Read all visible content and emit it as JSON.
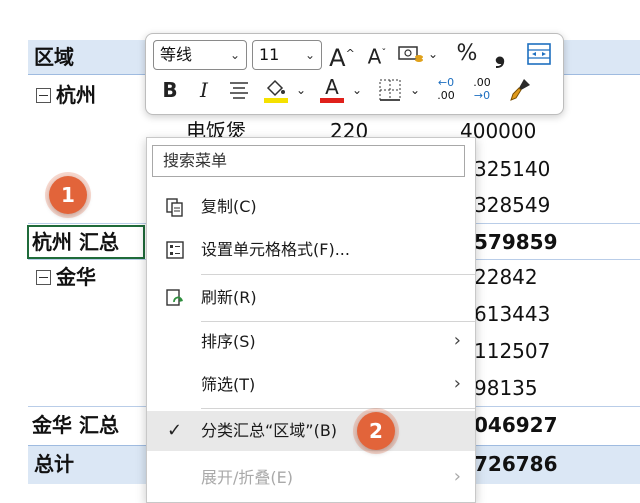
{
  "sheet": {
    "header_label": "区域",
    "group1": {
      "label": "杭州",
      "item": "电饭煲",
      "qty": "220",
      "amount": "400000"
    },
    "partial_values": [
      "325140",
      "328549",
      "579859",
      "22842",
      "613443",
      "112507",
      "98135",
      "046927",
      "726786"
    ],
    "subtotal1": "杭州 汇总",
    "group2": {
      "label": "金华"
    },
    "subtotal2": "金华 汇总",
    "grand_total": "总计"
  },
  "toolbar": {
    "font_name": "等线",
    "font_size": "11",
    "increase_font_glyph": "A",
    "decrease_font_glyph": "A",
    "percent_glyph": "%",
    "comma_glyph": "❟",
    "bold_glyph": "B",
    "italic_glyph": "I",
    "font_color_glyph": "A",
    "decimal_inc_top": "←0",
    "decimal_inc_bottom": ".00",
    "decimal_dec_top": ".00",
    "decimal_dec_bottom": "→0"
  },
  "menu": {
    "search_placeholder": "搜索菜单",
    "items": [
      {
        "label": "复制(C)"
      },
      {
        "label": "设置单元格格式(F)..."
      },
      {
        "label": "刷新(R)"
      },
      {
        "label": "排序(S)"
      },
      {
        "label": "筛选(T)"
      },
      {
        "label": "分类汇总“区域”(B)"
      },
      {
        "label": "展开/折叠(E)"
      }
    ],
    "check_glyph": "✓",
    "chevron_glyph": "›"
  },
  "badges": {
    "one": "1",
    "two": "2"
  },
  "colors": {
    "badge": "#e2643a",
    "highlight_yellow": "#f5e100",
    "font_red": "#e0201b",
    "selection_green": "#1f6b3a",
    "header_blue": "#dbe7f5"
  }
}
